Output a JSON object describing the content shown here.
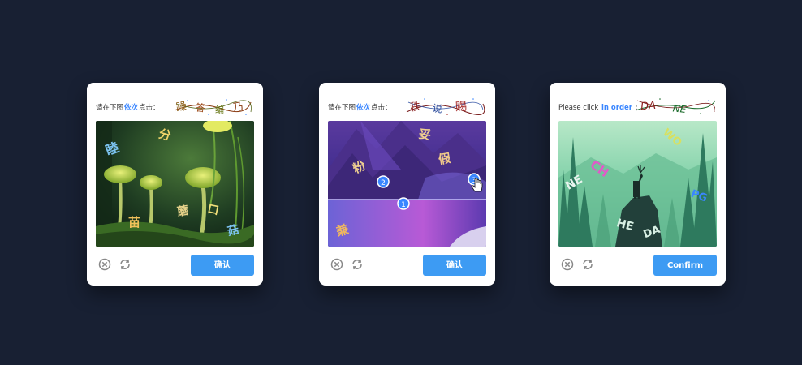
{
  "colors": {
    "background": "#182033",
    "accent": "#3d9bf3",
    "highlight": "#3a86ff"
  },
  "cards": [
    {
      "prompt_prefix": "请在下图",
      "prompt_highlight": "依次",
      "prompt_suffix": "点击：",
      "target_chars": [
        "躁",
        "答",
        "编",
        "乃"
      ],
      "scene_chars": [
        "睦",
        "分",
        "苗",
        "蘑",
        "口",
        "菇"
      ],
      "confirm_label": "确认",
      "icons": [
        "close-icon",
        "refresh-icon"
      ]
    },
    {
      "prompt_prefix": "请在下图",
      "prompt_highlight": "依次",
      "prompt_suffix": "点击：",
      "target_chars": [
        "秩",
        "说",
        "赐"
      ],
      "scene_chars": [
        "粉",
        "妥",
        "假",
        "兼"
      ],
      "click_markers": [
        "2",
        "1",
        "3"
      ],
      "confirm_label": "确认",
      "icons": [
        "close-icon",
        "refresh-icon",
        "hand-cursor-icon"
      ]
    },
    {
      "prompt_prefix": "Please click",
      "prompt_highlight": "in order",
      "prompt_suffix": ":",
      "target_chars": [
        "DA",
        "NE"
      ],
      "scene_chars": [
        "NE",
        "CH",
        "WO",
        "PG",
        "HE",
        "DA"
      ],
      "confirm_label": "Confirm",
      "icons": [
        "close-icon",
        "refresh-icon"
      ]
    }
  ]
}
